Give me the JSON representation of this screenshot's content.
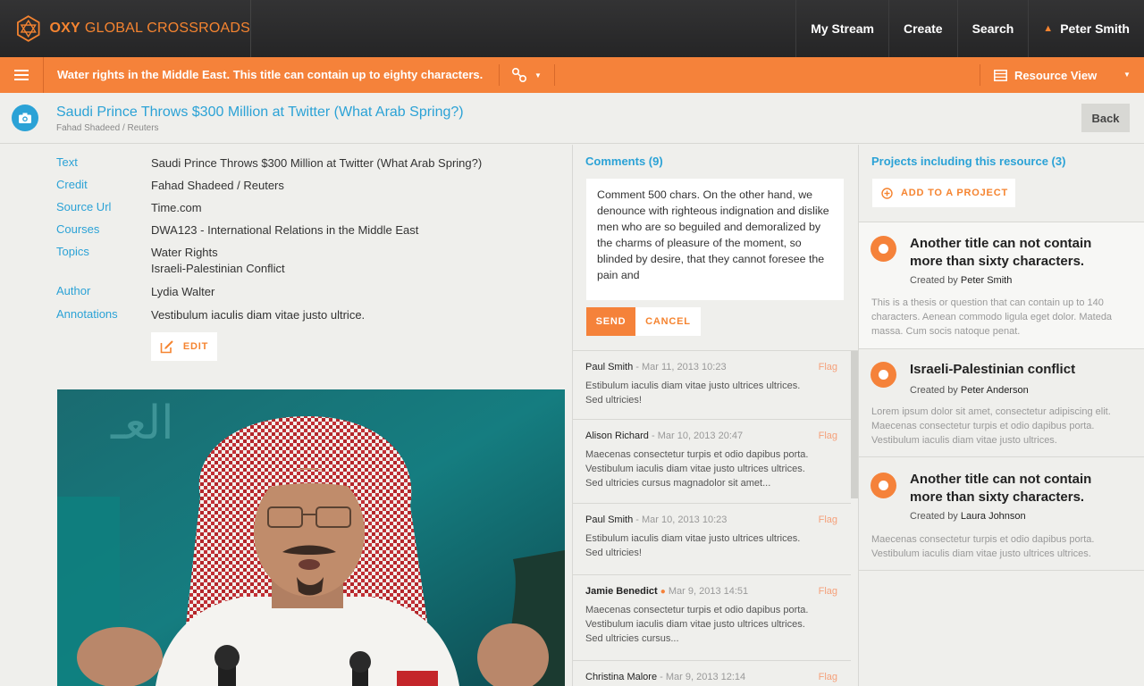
{
  "brand": {
    "bold": "OXY",
    "name": "GLOBAL CROSSROADS"
  },
  "topnav": {
    "stream": "My Stream",
    "create": "Create",
    "search": "Search",
    "user": "Peter Smith"
  },
  "stream_bar": {
    "title": "Water rights in the Middle East. This title can contain up to eighty characters.",
    "view": "Resource View"
  },
  "resource": {
    "title": "Saudi Prince Throws $300 Million at Twitter (What Arab Spring?)",
    "credit": "Fahad Shadeed / Reuters",
    "back_label": "Back"
  },
  "meta": {
    "text_label": "Text",
    "text_value": "Saudi Prince Throws $300 Million at Twitter (What Arab Spring?)",
    "credit_label": "Credit",
    "credit_value": "Fahad Shadeed / Reuters",
    "source_label": "Source Url",
    "source_value": "Time.com",
    "courses_label": "Courses",
    "courses_value": "DWA123 - International Relations in the Middle East",
    "topics_label": "Topics",
    "topics_value_1": "Water Rights",
    "topics_value_2": "Israeli-Palestinian Conflict",
    "author_label": "Author",
    "author_value": "Lydia Walter",
    "annotations_label": "Annotations",
    "annotations_value": "Vestibulum iaculis diam vitae justo ultrice.",
    "edit_label": "EDIT"
  },
  "comments": {
    "header": "Comments (9)",
    "draft": "Comment 500 chars. On the other hand, we denounce with righteous indignation and dislike men who are so beguiled and demoralized by the charms of pleasure of the moment, so blinded by desire, that they cannot foresee the pain and",
    "send_label": "SEND",
    "cancel_label": "CANCEL",
    "flag_label": "Flag",
    "items": [
      {
        "author": "Paul Smith",
        "date": "- Mar 11, 2013 10:23",
        "line1": "Estibulum iaculis diam vitae justo ultrices ultrices.",
        "line2": "Sed ultricies!",
        "line3": ""
      },
      {
        "author": "Alison Richard",
        "date": "- Mar 10, 2013 20:47",
        "line1": "Maecenas consectetur turpis et odio dapibus porta.",
        "line2": "Vestibulum iaculis diam vitae justo ultrices ultrices.",
        "line3": "Sed ultricies cursus magnadolor sit amet..."
      },
      {
        "author": "Paul Smith",
        "date": "- Mar 10, 2013 10:23",
        "line1": "Estibulum iaculis diam vitae justo ultrices ultrices.",
        "line2": "Sed ultricies!",
        "line3": ""
      },
      {
        "author": "Jamie Benedict",
        "date": "Mar 9, 2013 14:51",
        "line1": "Maecenas consectetur turpis et odio dapibus porta.",
        "line2": "Vestibulum iaculis diam vitae justo ultrices ultrices.",
        "line3": "Sed ultricies cursus..."
      },
      {
        "author": "Christina Malore",
        "date": "- Mar 9, 2013 12:14",
        "line1": "",
        "line2": "",
        "line3": ""
      }
    ]
  },
  "projects": {
    "header": "Projects including this resource (3)",
    "add_label": "ADD TO A PROJECT",
    "created_prefix": "Created by",
    "items": [
      {
        "title": "Another title can not contain more than sixty characters.",
        "creator": "Peter Smith",
        "desc": "This is a thesis or question that can contain up to 140 characters. Aenean commodo ligula eget dolor. Mateda massa. Cum socis natoque penat."
      },
      {
        "title": "Israeli-Palestinian conflict",
        "creator": "Peter Anderson",
        "desc": "Lorem ipsum dolor sit amet, consectetur adipiscing elit. Maecenas consectetur turpis et odio dapibus porta. Vestibulum iaculis diam vitae justo ultrices."
      },
      {
        "title": "Another title can not contain more than sixty characters.",
        "creator": "Laura Johnson",
        "desc": "Maecenas consectetur turpis et odio dapibus porta. Vestibulum iaculis diam vitae justo ultrices ultrices."
      }
    ]
  },
  "colors": {
    "accent": "#f5823a",
    "link": "#2ba2d6",
    "topbar": "#2b2b2c"
  },
  "icons": {
    "logo": "hexagon-star-logo",
    "menu": "hamburger-icon",
    "link": "link-nodes-icon",
    "view": "list-view-icon",
    "camera": "camera-icon",
    "edit": "edit-icon",
    "add": "plus-circle-icon",
    "user": "user-icon"
  }
}
